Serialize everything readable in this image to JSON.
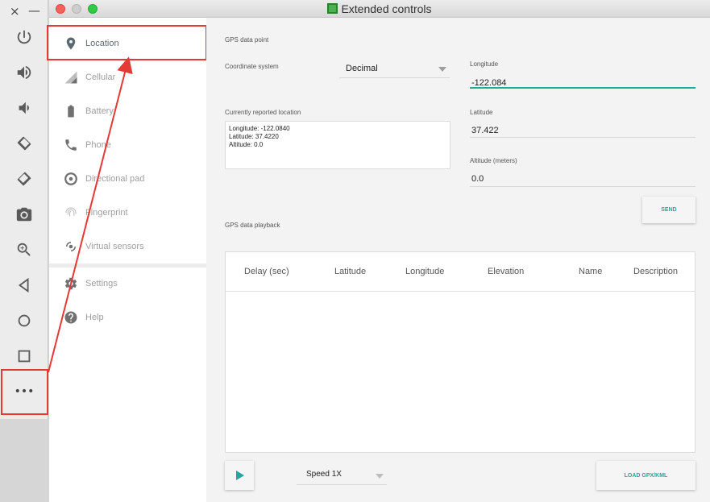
{
  "emulator_toolbar": {
    "close_glyph": "×",
    "minimize_glyph": "—",
    "buttons": [
      {
        "name": "power-icon"
      },
      {
        "name": "volume-up-icon"
      },
      {
        "name": "volume-down-icon"
      },
      {
        "name": "rotate-left-icon"
      },
      {
        "name": "rotate-right-icon"
      },
      {
        "name": "camera-icon"
      },
      {
        "name": "zoom-icon"
      },
      {
        "name": "back-icon"
      },
      {
        "name": "home-icon"
      },
      {
        "name": "overview-icon"
      },
      {
        "name": "more-icon"
      }
    ],
    "more_glyph": "•••"
  },
  "window": {
    "title": "Extended controls"
  },
  "sidenav": {
    "items": [
      {
        "label": "Location",
        "icon": "location-pin-icon"
      },
      {
        "label": "Cellular",
        "icon": "signal-icon"
      },
      {
        "label": "Battery",
        "icon": "battery-icon"
      },
      {
        "label": "Phone",
        "icon": "phone-icon"
      },
      {
        "label": "Directional pad",
        "icon": "dpad-icon"
      },
      {
        "label": "Fingerprint",
        "icon": "fingerprint-icon"
      },
      {
        "label": "Virtual sensors",
        "icon": "sensors-icon"
      },
      {
        "label": "Settings",
        "icon": "gear-icon"
      },
      {
        "label": "Help",
        "icon": "help-icon"
      }
    ]
  },
  "gps": {
    "section_title": "GPS data point",
    "coordinate_system_label": "Coordinate system",
    "coordinate_system_value": "Decimal",
    "longitude_label": "Longitude",
    "longitude_value": "-122.084",
    "latitude_label": "Latitude",
    "latitude_value": "37.422",
    "altitude_label": "Altitude (meters)",
    "altitude_value": "0.0",
    "reported_label": "Currently reported location",
    "reported_lines": [
      "Longitude: -122.0840",
      "Latitude: 37.4220",
      "Altitude: 0.0"
    ],
    "send_label": "SEND"
  },
  "playback": {
    "section_title": "GPS data playback",
    "columns": [
      "Delay (sec)",
      "Latitude",
      "Longitude",
      "Elevation",
      "Name",
      "Description"
    ],
    "rows": [],
    "speed_value": "Speed 1X",
    "load_label": "LOAD GPX/KML"
  },
  "colors": {
    "accent": "#26a69a",
    "annotation": "#e53935"
  }
}
